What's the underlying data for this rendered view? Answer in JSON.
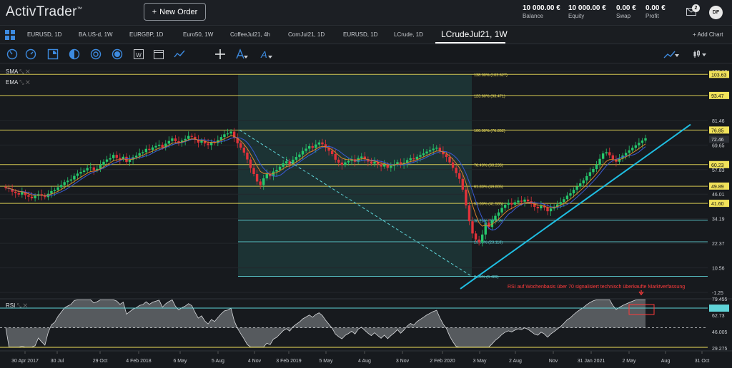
{
  "app": {
    "logo": "ActivTrader",
    "trademark": "™",
    "new_order": "New Order"
  },
  "account": [
    {
      "value": "10 000.00 €",
      "label": "Balance"
    },
    {
      "value": "10 000.00 €",
      "label": "Equity"
    },
    {
      "value": "0.00 €",
      "label": "Swap"
    },
    {
      "value": "0.00 €",
      "label": "Profit"
    }
  ],
  "notifications": "2",
  "user_initials": "DF",
  "tabs": [
    {
      "label": "EURUSD, 1D",
      "active": false
    },
    {
      "label": "BA.US-d, 1W",
      "active": false
    },
    {
      "label": "EURGBP, 1D",
      "active": false
    },
    {
      "label": "Euro50, 1W",
      "active": false
    },
    {
      "label": "CoffeeJul21, 4h",
      "active": false
    },
    {
      "label": "CornJul21, 1D",
      "active": false
    },
    {
      "label": "EURUSD, 1D",
      "active": false
    },
    {
      "label": "LCrude, 1D",
      "active": false
    },
    {
      "label": "LCrudeJul21, 1W",
      "active": true
    }
  ],
  "add_chart": "Add Chart",
  "toolbar_icons": [
    "crosshair-cursor-icon",
    "clock-icon",
    "pie-icon",
    "half-circle-icon",
    "target-icon",
    "ring-icon",
    "chart-type-icon",
    "calendar-icon",
    "trend-icon",
    "move-icon",
    "drawing-icon",
    "text-icon"
  ],
  "indicators": [
    "SMA",
    "EMA"
  ],
  "rsi_label": "RSI",
  "chart_data": {
    "type": "candlestick",
    "instrument": "LCrudeJul21",
    "timeframe": "1W",
    "x_tick_labels": [
      "30 Apr 2017",
      "30 Jul",
      "29 Oct",
      "4 Feb 2018",
      "6 May",
      "5 Aug",
      "4 Nov",
      "3 Feb 2019",
      "5 May",
      "4 Aug",
      "3 Nov",
      "2 Feb 2020",
      "3 May",
      "2 Aug",
      "Nov",
      "31 Jan 2021",
      "2 May",
      "Aug",
      "31 Oct"
    ],
    "y_ticks": [
      -1.25,
      10.56,
      22.37,
      34.19,
      46.01,
      57.83,
      69.65,
      81.46,
      105.1
    ],
    "ylim": [
      -1.25,
      105.1
    ],
    "fib_levels": [
      {
        "label": "0.00% (6.489)",
        "value": 6.489
      },
      {
        "label": "23.60% (23.118)",
        "value": 23.118
      },
      {
        "label": "38.20% (33.459)",
        "value": 33.459
      },
      {
        "label": "50.00% (41.585)",
        "value": 41.585
      },
      {
        "label": "61.80% (49.805)",
        "value": 49.805
      },
      {
        "label": "76.40% (60.235)",
        "value": 60.235
      },
      {
        "label": "100.00% (76.852)",
        "value": 76.852
      },
      {
        "label": "123.60% (93.471)",
        "value": 93.471
      },
      {
        "label": "138.00% (103.627)",
        "value": 103.627
      }
    ],
    "price_tags": [
      {
        "value": 103.63,
        "color": "#f1e25a",
        "text": "103.63"
      },
      {
        "value": 93.47,
        "color": "#f1e25a",
        "text": "93.47"
      },
      {
        "value": 76.85,
        "color": "#f1e25a",
        "text": "76.85"
      },
      {
        "value": 72.46,
        "color": "#2a2e34",
        "text": "72.46"
      },
      {
        "value": 60.23,
        "color": "#f1e25a",
        "text": "60.23"
      },
      {
        "value": 49.89,
        "color": "#f1e25a",
        "text": "49.89"
      },
      {
        "value": 41.6,
        "color": "#f1e25a",
        "text": "41.60"
      }
    ],
    "closes": [
      49.0,
      48.5,
      47.2,
      46.5,
      45.8,
      47.0,
      45.5,
      44.8,
      44.0,
      45.2,
      46.0,
      45.3,
      44.6,
      46.2,
      47.5,
      48.0,
      49.3,
      50.4,
      51.8,
      52.5,
      53.1,
      54.8,
      55.9,
      56.7,
      57.4,
      58.6,
      58.9,
      57.6,
      58.2,
      60.1,
      61.6,
      62.7,
      63.3,
      64.9,
      63.4,
      62.8,
      64.0,
      61.5,
      62.6,
      63.8,
      64.5,
      65.7,
      66.2,
      67.8,
      67.3,
      68.5,
      69.2,
      69.8,
      68.5,
      70.3,
      71.6,
      72.8,
      71.5,
      70.7,
      71.8,
      72.6,
      74.0,
      73.6,
      72.2,
      70.8,
      71.7,
      70.4,
      69.6,
      71.1,
      70.6,
      72.0,
      73.5,
      74.8,
      75.2,
      76.1,
      73.0,
      70.5,
      68.4,
      66.0,
      62.7,
      58.6,
      55.7,
      52.1,
      50.4,
      53.6,
      55.8,
      54.6,
      56.9,
      57.7,
      59.2,
      60.8,
      61.8,
      60.5,
      62.6,
      63.9,
      65.1,
      66.8,
      67.9,
      69.1,
      68.3,
      69.9,
      70.9,
      70.0,
      68.4,
      66.9,
      65.3,
      62.6,
      61.2,
      60.1,
      61.3,
      62.0,
      62.8,
      61.6,
      63.4,
      64.1,
      62.9,
      61.7,
      60.7,
      61.6,
      60.4,
      59.3,
      60.2,
      58.7,
      59.6,
      60.4,
      61.4,
      60.1,
      61.1,
      62.4,
      63.3,
      62.8,
      64.0,
      64.8,
      65.6,
      66.5,
      67.2,
      67.9,
      68.4,
      66.8,
      65.2,
      63.9,
      61.3,
      58.7,
      56.1,
      53.4,
      48.2,
      40.6,
      33.0,
      27.1,
      24.2,
      22.8,
      26.6,
      32.3,
      30.2,
      33.4,
      35.6,
      37.2,
      39.4,
      40.9,
      41.8,
      41.0,
      42.1,
      42.9,
      42.4,
      43.4,
      42.6,
      41.3,
      39.9,
      39.2,
      40.5,
      39.6,
      37.8,
      39.1,
      40.0,
      41.1,
      42.2,
      43.6,
      45.3,
      46.4,
      48.1,
      49.7,
      51.2,
      52.6,
      54.7,
      56.6,
      58.1,
      60.2,
      63.0,
      65.6,
      66.2,
      64.7,
      62.9,
      61.6,
      63.1,
      64.6,
      65.9,
      67.1,
      68.3,
      69.5,
      70.7,
      71.8,
      72.9
    ],
    "rsi": {
      "ylim": [
        29.275,
        79.455
      ],
      "ticks": [
        29.275,
        46.005,
        62.73,
        79.455
      ],
      "overbought": 70,
      "oversold": 30
    },
    "annotation": "RSI auf Wochenbasis über 70 signalisiert technisch überkaufte Marktverfassung"
  },
  "colors": {
    "bg": "#171a1e",
    "up": "#26c66b",
    "down": "#e0323a",
    "fib": "#5fd4d8",
    "gold": "#f1e25a",
    "trend": "#1fbfe3",
    "ema": "#d9822b",
    "sma": "#3b5bd6",
    "rsi_fill": "#8b8f94",
    "annot": "#ff3b3b"
  }
}
